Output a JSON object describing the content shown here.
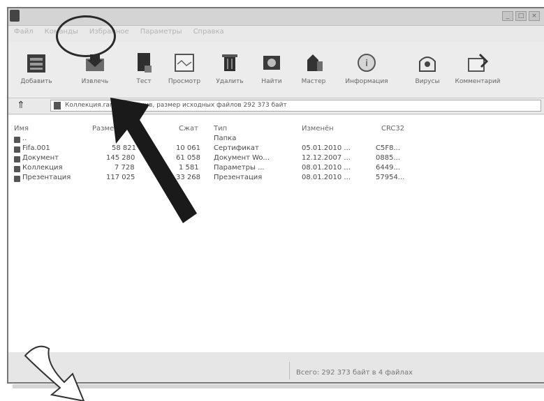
{
  "menubar": {
    "items": [
      "Файл",
      "Команды",
      "Избранное",
      "Параметры",
      "Справка"
    ]
  },
  "toolbar": {
    "buttons": [
      {
        "label": "Добавить",
        "icon": "add-archive-icon"
      },
      {
        "label": "Извлечь",
        "icon": "extract-icon"
      },
      {
        "label": "Тест",
        "icon": "test-icon"
      },
      {
        "label": "Просмотр",
        "icon": "view-icon"
      },
      {
        "label": "Удалить",
        "icon": "delete-icon"
      },
      {
        "label": "Найти",
        "icon": "find-icon"
      },
      {
        "label": "Мастер",
        "icon": "wizard-icon"
      },
      {
        "label": "Информация",
        "icon": "info-icon"
      },
      {
        "label": "Вирусы",
        "icon": "virus-scan-icon"
      },
      {
        "label": "Комментарий",
        "icon": "comment-icon"
      }
    ]
  },
  "addressbar": {
    "up_glyph": "⇑",
    "path": "Коллекция.rar - RAR архив, размер исходных файлов 292 373 байт"
  },
  "filelist": {
    "columns": [
      "Имя",
      "Размер",
      "Сжат",
      "Тип",
      "Изменён",
      "CRC32"
    ],
    "rows": [
      {
        "name": "..",
        "size": "",
        "packed": "",
        "type": "Папка",
        "modified": "",
        "crc": ""
      },
      {
        "name": "Fifa.001",
        "size": "58 821",
        "packed": "10 061",
        "type": "Сертификат",
        "modified": "05.01.2010 ...",
        "crc": "C5F8..."
      },
      {
        "name": "Документ",
        "size": "145 280",
        "packed": "61 058",
        "type": "Документ Wo...",
        "modified": "12.12.2007 ...",
        "crc": "0885..."
      },
      {
        "name": "Коллекция",
        "size": "7 728",
        "packed": "1 581",
        "type": "Параметры ...",
        "modified": "08.01.2010 ...",
        "crc": "6449..."
      },
      {
        "name": "Презентация",
        "size": "117 025",
        "packed": "33 268",
        "type": "Презентация",
        "modified": "08.01.2010 ...",
        "crc": "57954..."
      }
    ]
  },
  "statusbar": {
    "left": "",
    "right": "Всего: 292 373 байт в 4 файлах"
  },
  "colors": {
    "arrow": "#1a1a1a",
    "highlight_ring": "#2a2a2a",
    "window_bg": "#e9e9e9"
  }
}
